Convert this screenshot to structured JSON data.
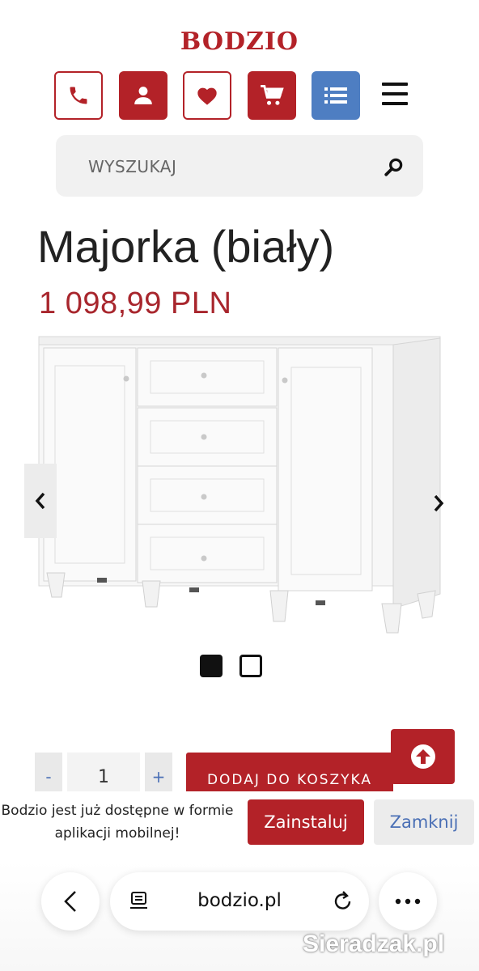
{
  "header": {
    "logo": "BODZIO",
    "icons": [
      "phone-icon",
      "user-icon",
      "heart-icon",
      "cart-icon",
      "list-icon",
      "menu-icon"
    ],
    "brand_color": "#b32228",
    "blue_accent": "#4e7ec2"
  },
  "search": {
    "placeholder": "WYSZUKAJ"
  },
  "product": {
    "title": "Majorka (biały)",
    "price": "1 098,99 PLN",
    "gallery_pages": 2,
    "gallery_active": 1
  },
  "purchase": {
    "minus": "-",
    "quantity": "1",
    "plus": "+",
    "add_to_cart": "DODAJ DO KOSZYKA"
  },
  "app_banner": {
    "message": "Bodzio jest już dostępne w formie aplikacji mobilnej!",
    "install": "Zainstaluj",
    "close": "Zamknij"
  },
  "browser": {
    "url": "bodzio.pl"
  },
  "watermark": "Sieradzak.pl"
}
